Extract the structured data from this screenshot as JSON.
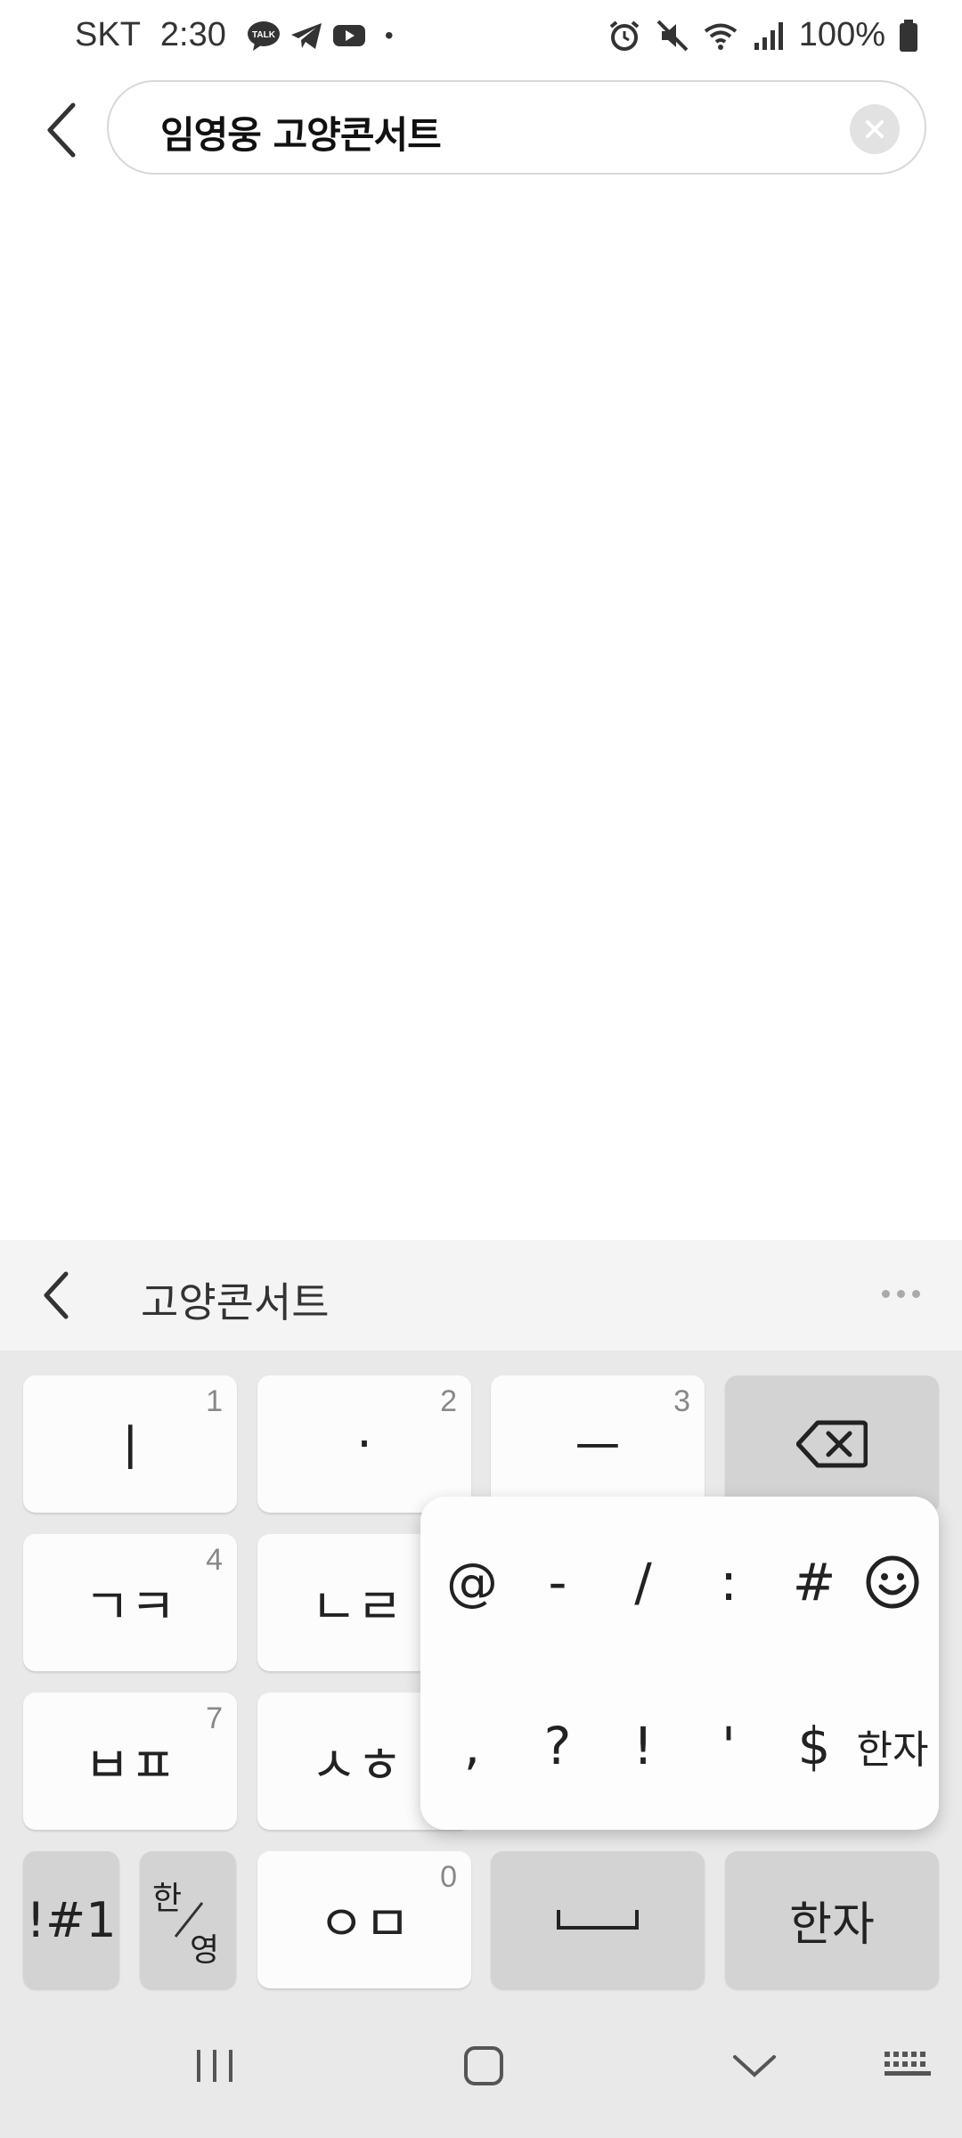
{
  "status_bar": {
    "carrier": "SKT",
    "time": "2:30",
    "dot": "•",
    "battery_percent": "100%"
  },
  "search": {
    "query": "임영웅 고양콘서트"
  },
  "suggestion": {
    "text": "고양콘서트"
  },
  "keyboard": {
    "row1": [
      {
        "label": "ㅣ",
        "hint": "1"
      },
      {
        "label": "·",
        "hint": "2"
      },
      {
        "label": "ㅡ",
        "hint": "3"
      }
    ],
    "row2": [
      {
        "label": "ㄱㅋ",
        "hint": "4"
      },
      {
        "label": "ㄴㄹ",
        "hint": ""
      }
    ],
    "row3": [
      {
        "label": "ㅂㅍ",
        "hint": "7"
      },
      {
        "label": "ㅅㅎ",
        "hint": ""
      }
    ],
    "row4": {
      "symbols": "!#1",
      "lang_top": "한",
      "lang_bottom": "영",
      "om": "ㅇㅁ",
      "om_hint": "0",
      "hanja": "한자"
    }
  },
  "popup": {
    "row1": [
      "@",
      "-",
      "/",
      ":",
      "#"
    ],
    "row2": [
      ",",
      "?",
      "!",
      "'",
      "$"
    ],
    "hanja": "한자"
  },
  "colors": {
    "keyboard_bg": "#e9e9e9",
    "key_light": "#fcfcfc",
    "key_dark": "#d3d3d3"
  }
}
